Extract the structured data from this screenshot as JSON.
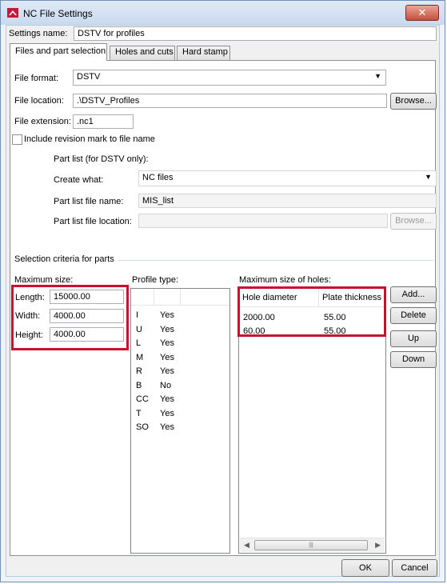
{
  "window": {
    "title": "NC File Settings",
    "close_symbol": "✕"
  },
  "settings_name": {
    "label": "Settings name:",
    "value": "DSTV for profiles"
  },
  "tabs": [
    {
      "label": "Files and part selection"
    },
    {
      "label": "Holes and cuts"
    },
    {
      "label": "Hard stamp"
    }
  ],
  "file_format": {
    "label": "File format:",
    "value": "DSTV"
  },
  "file_location": {
    "label": "File location:",
    "value": ".\\DSTV_Profiles",
    "browse": "Browse..."
  },
  "file_extension": {
    "label": "File extension:",
    "value": ".nc1"
  },
  "revision_mark": {
    "label": "Include revision mark to file name"
  },
  "part_list": {
    "title": "Part list (for DSTV only):",
    "create_what_label": "Create what:",
    "create_what_value": "NC files",
    "file_name_label": "Part list file name:",
    "file_name_value": "MIS_list",
    "file_location_label": "Part list file location:",
    "file_location_value": "",
    "browse": "Browse..."
  },
  "selection_criteria": {
    "title": "Selection criteria for parts"
  },
  "max_size": {
    "title": "Maximum size:",
    "length_label": "Length:",
    "length_value": "15000.00",
    "width_label": "Width:",
    "width_value": "4000.00",
    "height_label": "Height:",
    "height_value": "4000.00"
  },
  "profile_type": {
    "title": "Profile type:",
    "rows": [
      {
        "type": "I",
        "value": "Yes"
      },
      {
        "type": "U",
        "value": "Yes"
      },
      {
        "type": "L",
        "value": "Yes"
      },
      {
        "type": "M",
        "value": "Yes"
      },
      {
        "type": "R",
        "value": "Yes"
      },
      {
        "type": "B",
        "value": "No"
      },
      {
        "type": "CC",
        "value": "Yes"
      },
      {
        "type": "T",
        "value": "Yes"
      },
      {
        "type": "SO",
        "value": "Yes"
      }
    ]
  },
  "holes": {
    "title": "Maximum size of holes:",
    "columns": [
      "Hole diameter",
      "Plate thickness"
    ],
    "rows": [
      {
        "diameter": "2000.00",
        "thickness": "55.00"
      },
      {
        "diameter": "60.00",
        "thickness": "55.00"
      }
    ],
    "add": "Add...",
    "delete": "Delete",
    "up": "Up",
    "down": "Down"
  },
  "footer": {
    "ok": "OK",
    "cancel": "Cancel"
  },
  "colors": {
    "highlight": "#c8102e",
    "titlebar": "#c9daee"
  }
}
